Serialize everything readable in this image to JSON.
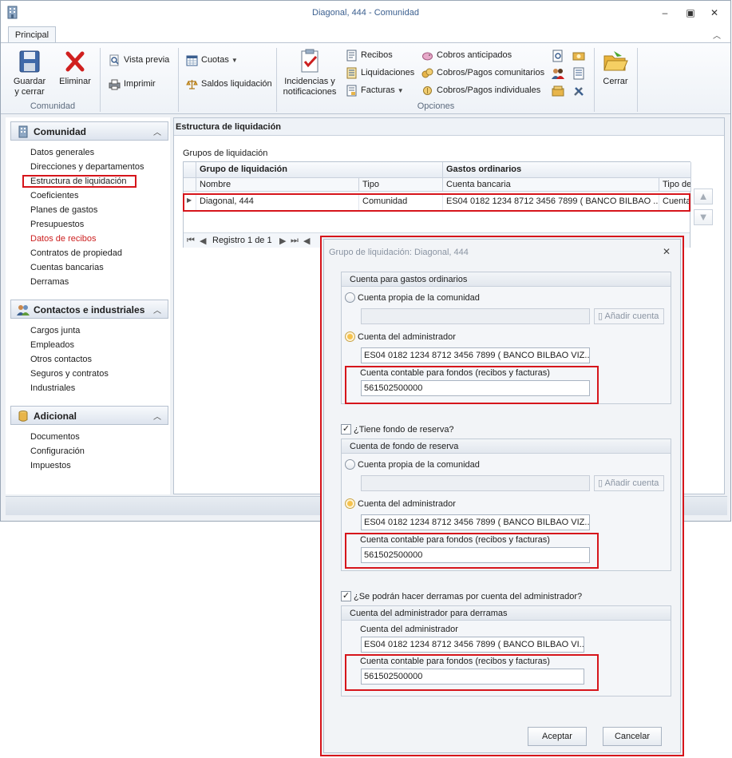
{
  "window": {
    "title": "Diagonal, 444 - Comunidad"
  },
  "ribbon": {
    "tab": "Principal",
    "groups": {
      "comunidad": "Comunidad",
      "opciones": "Opciones"
    },
    "buttons": {
      "guardar_line1": "Guardar",
      "guardar_line2": "y cerrar",
      "eliminar": "Eliminar",
      "vista_previa": "Vista previa",
      "imprimir": "Imprimir",
      "cuotas": "Cuotas",
      "saldos": "Saldos liquidación",
      "incidencias_line1": "Incidencias y",
      "incidencias_line2": "notificaciones",
      "recibos": "Recibos",
      "liquidaciones": "Liquidaciones",
      "facturas": "Facturas",
      "cobros_anticipados": "Cobros anticipados",
      "cobros_comunitarios": "Cobros/Pagos comunitarios",
      "cobros_individuales": "Cobros/Pagos individuales",
      "cerrar": "Cerrar"
    }
  },
  "nav": {
    "sections": [
      {
        "title": "Comunidad",
        "items": [
          "Datos generales",
          "Direcciones y departamentos",
          "Estructura de liquidación",
          "Coeficientes",
          "Planes de gastos",
          "Presupuestos",
          "Datos de recibos",
          "Contratos de propiedad",
          "Cuentas bancarias",
          "Derramas"
        ]
      },
      {
        "title": "Contactos e industriales",
        "items": [
          "Cargos junta",
          "Empleados",
          "Otros contactos",
          "Seguros y contratos",
          "Industriales"
        ]
      },
      {
        "title": "Adicional",
        "items": [
          "Documentos",
          "Configuración",
          "Impuestos"
        ]
      }
    ]
  },
  "content": {
    "header": "Estructura de liquidación",
    "groups_label": "Grupos de liquidación",
    "grid": {
      "bands": [
        "Grupo de liquidación",
        "Gastos ordinarios"
      ],
      "columns": [
        "Nombre",
        "Tipo",
        "Cuenta bancaria",
        "Tipo de"
      ],
      "row": [
        "Diagonal, 444",
        "Comunidad",
        "ES04 0182 1234 8712 3456 7899 ( BANCO BILBAO ...",
        "Cuenta"
      ],
      "record_text": "Registro 1 de 1"
    }
  },
  "dialog": {
    "title": "Grupo de liquidación: Diagonal, 444",
    "ordinary": {
      "legend": "Cuenta para gastos ordinarios",
      "own_label": "Cuenta propia de la comunidad",
      "own_value": "",
      "add_label": "Añadir cuenta",
      "admin_label": "Cuenta del administrador",
      "admin_value": "ES04 0182 1234 8712 3456 7899 ( BANCO BILBAO VIZ...",
      "fund_label": "Cuenta contable para fondos (recibos y facturas)",
      "fund_value": "561502500000"
    },
    "reserve_check": "¿Tiene fondo de reserva?",
    "reserve": {
      "legend": "Cuenta de fondo de reserva",
      "own_label": "Cuenta propia de la comunidad",
      "own_value": "",
      "add_label": "Añadir cuenta",
      "admin_label": "Cuenta del administrador",
      "admin_value": "ES04 0182 1234 8712 3456 7899 ( BANCO BILBAO VIZ...",
      "fund_label": "Cuenta contable para fondos (recibos y facturas)",
      "fund_value": "561502500000"
    },
    "derramas_check": "¿Se podrán hacer derramas por cuenta del administrador?",
    "derramas": {
      "legend": "Cuenta del administrador para derramas",
      "admin_label": "Cuenta del administrador",
      "admin_value": "ES04 0182 1234 8712 3456 7899 ( BANCO BILBAO VI...",
      "fund_label": "Cuenta contable para fondos (recibos y facturas)",
      "fund_value": "561502500000"
    },
    "accept": "Aceptar",
    "cancel": "Cancelar"
  },
  "colors": {
    "highlight": "#d6151b",
    "nav_red": "#cc1f1f",
    "title_blue": "#3b5f8f"
  }
}
